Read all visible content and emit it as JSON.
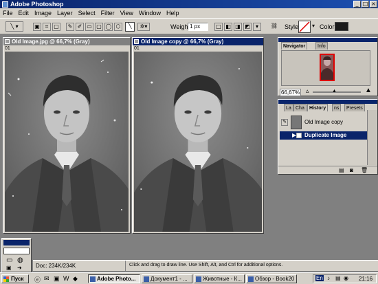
{
  "window": {
    "title": "Adobe Photoshop"
  },
  "menu": [
    "File",
    "Edit",
    "Image",
    "Layer",
    "Select",
    "Filter",
    "View",
    "Window",
    "Help"
  ],
  "options": {
    "weight_label": "Weight:",
    "weight_value": "1 px",
    "style_label": "Style:",
    "color_label": "Color:",
    "color_value": "#1a1a1a"
  },
  "documents": [
    {
      "title": "Old Image.jpg @ 66,7% (Gray)",
      "ruler": "01",
      "active": false
    },
    {
      "title": "Old Image copy @ 66,7% (Gray)",
      "ruler": "01",
      "active": true
    }
  ],
  "navigator": {
    "tabs": [
      "Navigator",
      "Info"
    ],
    "zoom": "66,67%"
  },
  "history": {
    "tabs": [
      "La",
      "Cha",
      "History",
      "ns",
      "Presets"
    ],
    "items": [
      {
        "label": "Old Image copy",
        "selected": false
      },
      {
        "label": "Duplicate Image",
        "selected": true
      }
    ]
  },
  "status": {
    "doc": "Doc: 234K/234K",
    "hint": "Click and drag to draw line. Use Shift, Alt, and Ctrl for additional options."
  },
  "taskbar": {
    "start": "Пуск",
    "tasks": [
      {
        "label": "Adobe Photo...",
        "active": true
      },
      {
        "label": "Документ1 - ...",
        "active": false
      },
      {
        "label": "Животные - К...",
        "active": false
      },
      {
        "label": "Обзор - Book20",
        "active": false
      }
    ],
    "lang": "En",
    "clock": "21:16"
  }
}
